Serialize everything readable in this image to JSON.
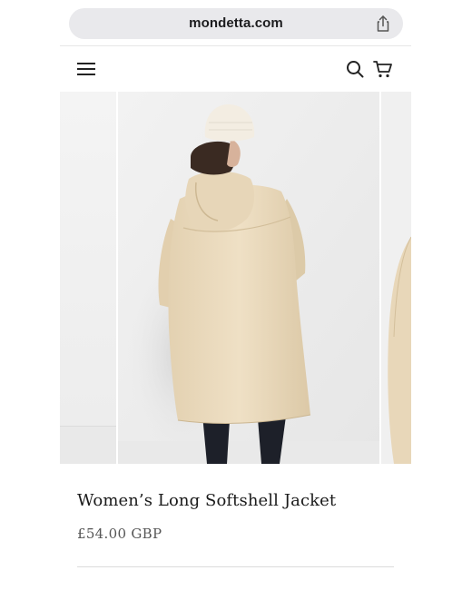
{
  "browser": {
    "url": "mondetta.com",
    "share_icon": "share-icon"
  },
  "header": {
    "menu_icon": "hamburger-menu-icon",
    "search_icon": "search-icon",
    "cart_icon": "cart-icon"
  },
  "product": {
    "title": "Women’s Long Softshell Jacket",
    "price": "£54.00 GBP"
  },
  "colors": {
    "jacket": "#ecdcbf",
    "background": "#eeeeee",
    "leggings": "#1d2029"
  }
}
